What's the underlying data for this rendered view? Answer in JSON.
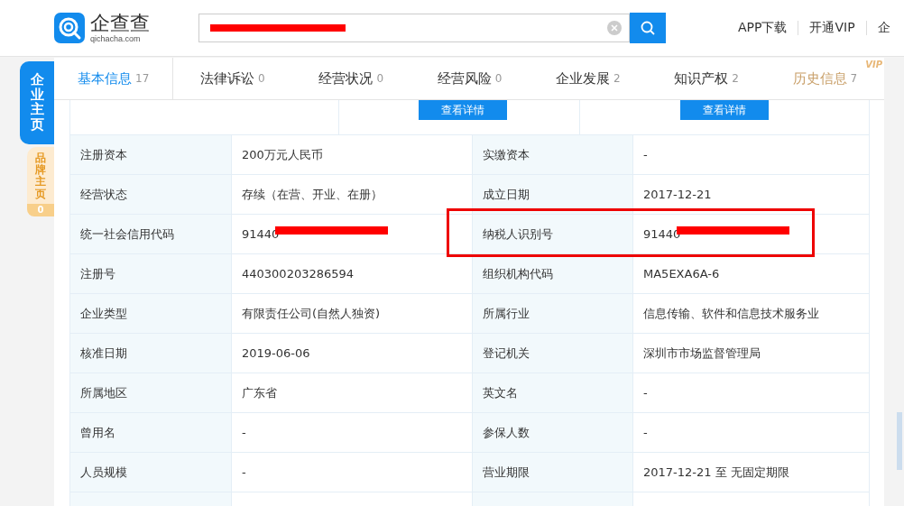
{
  "header": {
    "logo_text": "企查查",
    "logo_sub": "qichacha.com",
    "search": {
      "redacted": true
    },
    "links": [
      "APP下载",
      "开通VIP",
      "企"
    ]
  },
  "side_tabs": [
    {
      "label": "企业主页",
      "selected": true
    },
    {
      "label": "品牌主页",
      "selected": false,
      "count": "0"
    }
  ],
  "tabs": [
    {
      "label": "基本信息",
      "count": "17",
      "selected": true,
      "kind": "normal"
    },
    {
      "label": "法律诉讼",
      "count": "0",
      "selected": false,
      "kind": "normal"
    },
    {
      "label": "经营状况",
      "count": "0",
      "selected": false,
      "kind": "normal"
    },
    {
      "label": "经营风险",
      "count": "0",
      "selected": false,
      "kind": "normal"
    },
    {
      "label": "企业发展",
      "count": "2",
      "selected": false,
      "kind": "normal"
    },
    {
      "label": "知识产权",
      "count": "2",
      "selected": false,
      "kind": "normal"
    },
    {
      "label": "历史信息",
      "count": "7",
      "selected": false,
      "kind": "vip",
      "badge": "VIP"
    }
  ],
  "detail_buttons": [
    "查看详情",
    "查看详情"
  ],
  "rows": [
    {
      "cells": [
        {
          "label": "注册资本",
          "value": "200万元人民币"
        },
        {
          "label": "实缴资本",
          "value": "-"
        }
      ]
    },
    {
      "cells": [
        {
          "label": "经营状态",
          "value": "存续（在营、开业、在册）"
        },
        {
          "label": "成立日期",
          "value": "2017-12-21"
        }
      ]
    },
    {
      "cells": [
        {
          "label": "统一社会信用代码",
          "value": "91440",
          "redacted": true
        },
        {
          "label": "纳税人识别号",
          "value": "91440",
          "redacted": true,
          "highlighted": true
        }
      ]
    },
    {
      "cells": [
        {
          "label": "注册号",
          "value": "440300203286594"
        },
        {
          "label": "组织机构代码",
          "value": "MA5EXA6A-6"
        }
      ]
    },
    {
      "cells": [
        {
          "label": "企业类型",
          "value": "有限责任公司(自然人独资)"
        },
        {
          "label": "所属行业",
          "value": "信息传输、软件和信息技术服务业"
        }
      ]
    },
    {
      "cells": [
        {
          "label": "核准日期",
          "value": "2019-06-06"
        },
        {
          "label": "登记机关",
          "value": "深圳市市场监督管理局"
        }
      ]
    },
    {
      "cells": [
        {
          "label": "所属地区",
          "value": "广东省"
        },
        {
          "label": "英文名",
          "value": "-"
        }
      ]
    },
    {
      "cells": [
        {
          "label": "曾用名",
          "value": "-"
        },
        {
          "label": "参保人数",
          "value": "-"
        }
      ]
    },
    {
      "cells": [
        {
          "label": "人员规模",
          "value": "-"
        },
        {
          "label": "营业期限",
          "value": "2017-12-21 至 无固定期限"
        }
      ]
    }
  ]
}
